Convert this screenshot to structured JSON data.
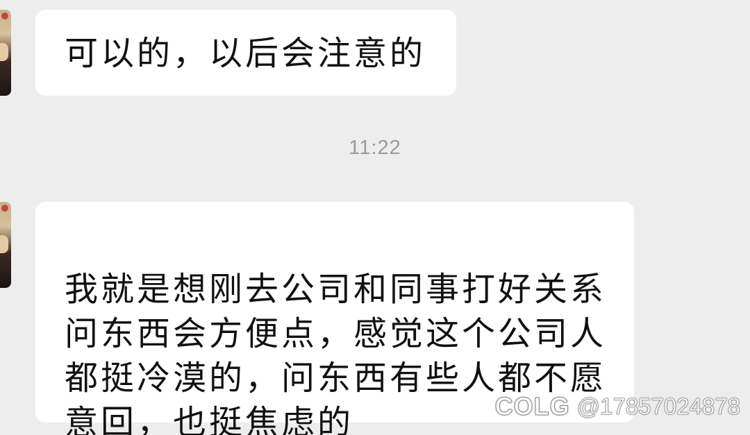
{
  "messages": [
    {
      "text": "可以的，以后会注意的"
    },
    {
      "text": "我就是想刚去公司和同事打好关系\n问东西会方便点，感觉这个公司人\n都挺冷漠的，问东西有些人都不愿\n意回，也挺焦虑的"
    }
  ],
  "timestamp": "11:22",
  "watermark": {
    "brand": "COLG",
    "handle": "@17857024878"
  },
  "colors": {
    "background": "#ededed",
    "bubble": "#ffffff",
    "text": "#111111",
    "timestamp": "#9a9a9a"
  },
  "icons": {
    "avatar": "user-avatar"
  }
}
